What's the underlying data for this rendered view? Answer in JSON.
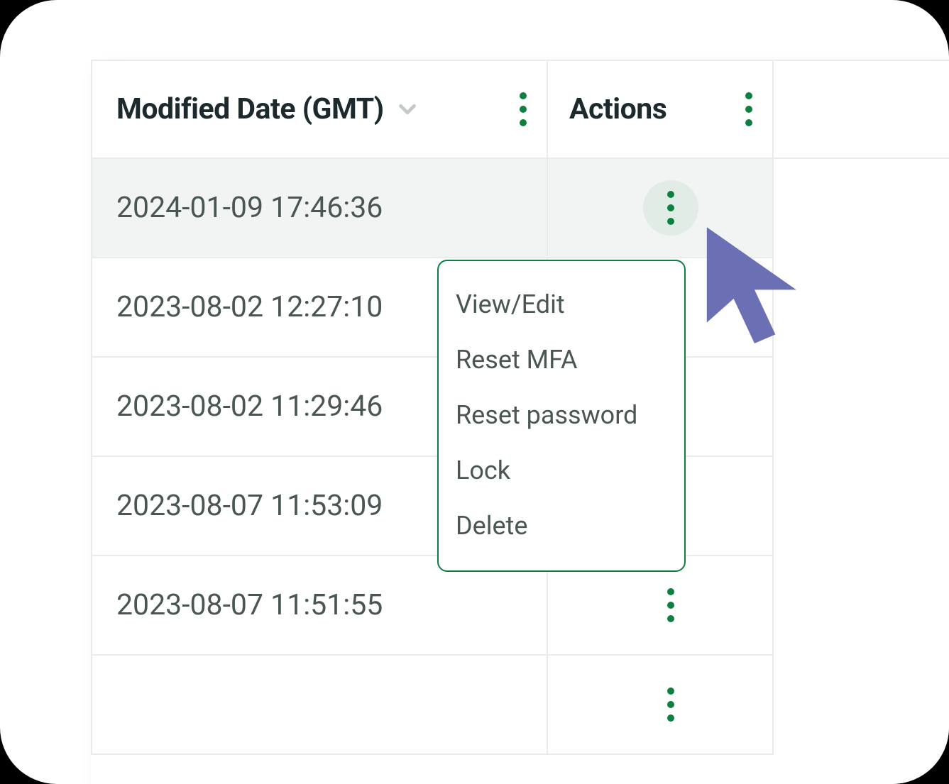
{
  "columns": {
    "modified_date": {
      "label": "Modified Date (GMT)"
    },
    "actions": {
      "label": "Actions"
    }
  },
  "rows": [
    {
      "modified": "2024-01-09 17:46:36",
      "highlight": true,
      "kebab_active": true
    },
    {
      "modified": "2023-08-02 12:27:10",
      "highlight": false,
      "kebab_active": false
    },
    {
      "modified": "2023-08-02 11:29:46",
      "highlight": false,
      "kebab_active": false
    },
    {
      "modified": "2023-08-07 11:53:09",
      "highlight": false,
      "kebab_active": false
    },
    {
      "modified": "2023-08-07 11:51:55",
      "highlight": false,
      "kebab_active": false
    },
    {
      "modified": "",
      "highlight": false,
      "kebab_active": false
    }
  ],
  "action_menu": {
    "items": [
      "View/Edit",
      "Reset MFA",
      "Reset password",
      "Lock",
      "Delete"
    ]
  },
  "colors": {
    "accent_green": "#0d7f3f",
    "cursor": "#6b6fb3"
  }
}
